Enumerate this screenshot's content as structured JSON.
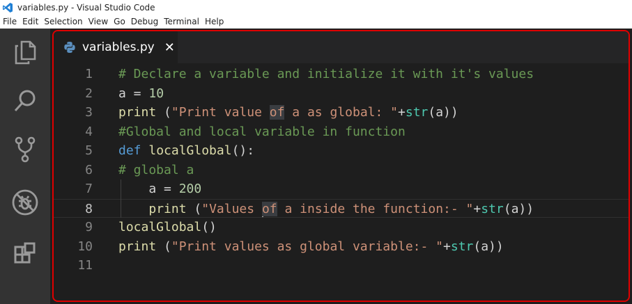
{
  "window": {
    "title": "variables.py - Visual Studio Code"
  },
  "menu": [
    "File",
    "Edit",
    "Selection",
    "View",
    "Go",
    "Debug",
    "Terminal",
    "Help"
  ],
  "activity_bar": [
    "explorer-icon",
    "search-icon",
    "source-control-icon",
    "debug-icon",
    "extensions-icon"
  ],
  "tab": {
    "label": "variables.py",
    "close": "✕"
  },
  "colors": {
    "highlight_border": "#e00000",
    "editor_bg": "#1e1e1e",
    "activity_bg": "#333333"
  },
  "editor": {
    "current_line": 8,
    "lines": [
      {
        "n": "1",
        "tokens": [
          [
            "comment",
            "# Declare a variable and initialize it with it's values"
          ]
        ]
      },
      {
        "n": "2",
        "tokens": [
          [
            "plain",
            "a = "
          ],
          [
            "num",
            "10"
          ]
        ]
      },
      {
        "n": "3",
        "tokens": [
          [
            "fn",
            "print"
          ],
          [
            "plain",
            " ("
          ],
          [
            "str",
            "\"Print value "
          ],
          [
            "strhl",
            "of"
          ],
          [
            "str",
            " a as global: \""
          ],
          [
            "plain",
            "+"
          ],
          [
            "builtin",
            "str"
          ],
          [
            "plain",
            "(a))"
          ]
        ]
      },
      {
        "n": "4",
        "tokens": [
          [
            "comment",
            "#Global and local variable in function"
          ]
        ]
      },
      {
        "n": "5",
        "tokens": [
          [
            "kw",
            "def"
          ],
          [
            "plain",
            " "
          ],
          [
            "fn",
            "localGlobal"
          ],
          [
            "plain",
            "():"
          ]
        ]
      },
      {
        "n": "6",
        "tokens": [
          [
            "comment",
            "# global a"
          ]
        ]
      },
      {
        "n": "7",
        "tokens": [
          [
            "plain",
            "    a = "
          ],
          [
            "num",
            "200"
          ]
        ]
      },
      {
        "n": "8",
        "tokens": [
          [
            "plain",
            "    "
          ],
          [
            "fn",
            "print"
          ],
          [
            "plain",
            " ("
          ],
          [
            "str",
            "\"Values "
          ],
          [
            "cursor",
            ""
          ],
          [
            "strhl",
            "of"
          ],
          [
            "str",
            " a inside the function:- \""
          ],
          [
            "plain",
            "+"
          ],
          [
            "builtin",
            "str"
          ],
          [
            "plain",
            "(a))"
          ]
        ]
      },
      {
        "n": "9",
        "tokens": [
          [
            "fn",
            "localGlobal"
          ],
          [
            "plain",
            "()"
          ]
        ]
      },
      {
        "n": "10",
        "tokens": [
          [
            "fn",
            "print"
          ],
          [
            "plain",
            " ("
          ],
          [
            "str",
            "\"Print values as global variable:- \""
          ],
          [
            "plain",
            "+"
          ],
          [
            "builtin",
            "str"
          ],
          [
            "plain",
            "(a))"
          ]
        ]
      },
      {
        "n": "11",
        "tokens": []
      }
    ]
  }
}
